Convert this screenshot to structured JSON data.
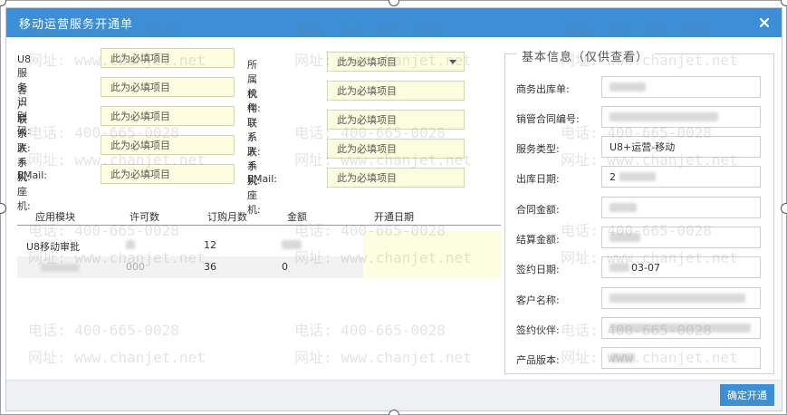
{
  "dialog": {
    "title": "移动运营服务开通单",
    "close_icon": "close-icon"
  },
  "form": {
    "left": [
      {
        "label": "U8服务识别码:",
        "placeholder": "此为必填项目"
      },
      {
        "label": "客户联系人:",
        "placeholder": "此为必填项目"
      },
      {
        "label": "联系人手机:",
        "placeholder": "此为必填项目"
      },
      {
        "label": "联系人座机:",
        "placeholder": "此为必填项目"
      },
      {
        "label": "EMail:",
        "placeholder": "此为必填项目"
      }
    ],
    "right": [
      {
        "label": "所属机构:",
        "value": "此为必填项目",
        "type": "select"
      },
      {
        "label": "伙伴联系人:",
        "placeholder": "此为必填项目"
      },
      {
        "label": "联系人手机:",
        "placeholder": "此为必填项目"
      },
      {
        "label": "联系人座机:",
        "placeholder": "此为必填项目"
      },
      {
        "label": "EMail:",
        "placeholder": "此为必填项目"
      }
    ]
  },
  "table": {
    "headers": [
      "应用模块",
      "许可数",
      "订购月数",
      "金额",
      "开通日期"
    ],
    "rows": [
      {
        "module": "U8移动审批",
        "license": "",
        "months": "12",
        "amount": ""
      },
      {
        "module": "",
        "license": "000",
        "months": "36",
        "amount": "0"
      }
    ]
  },
  "info": {
    "legend": "基本信息（仅供查看）",
    "fields": [
      {
        "label": "商务出库单:",
        "value": ""
      },
      {
        "label": "销管合同编号:",
        "value": ""
      },
      {
        "label": "服务类型:",
        "value": "U8+运营-移动"
      },
      {
        "label": "出库日期:",
        "value": "2"
      },
      {
        "label": "合同金额:",
        "value": ""
      },
      {
        "label": "结算金额:",
        "value": ""
      },
      {
        "label": "签约日期:",
        "value": "03-07"
      },
      {
        "label": "客户名称:",
        "value": ""
      },
      {
        "label": "签约伙伴:",
        "value": ""
      },
      {
        "label": "产品版本:",
        "value": ""
      }
    ]
  },
  "watermark": {
    "phone": "电话: 400-665-0028",
    "site": "网址: www.chanjet.net"
  },
  "footer": {
    "confirm_label": "确定开通"
  },
  "colors": {
    "titlebar": "#3c8fd6",
    "required_input_bg": "#fdfde0",
    "button": "#3c8fd6"
  }
}
